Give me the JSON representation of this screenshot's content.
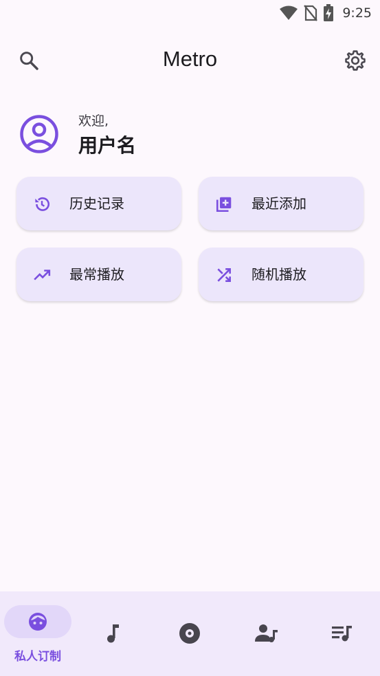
{
  "status_bar": {
    "time": "9:25",
    "icons": [
      "wifi-icon",
      "no-sim-icon",
      "battery-charging-icon"
    ]
  },
  "app_bar": {
    "title": "Metro",
    "left_icon": "search-icon",
    "right_icon": "settings-gear-icon"
  },
  "welcome": {
    "greeting": "欢迎,",
    "username": "用户名",
    "avatar_icon": "account-circle-icon"
  },
  "cards": [
    {
      "label": "历史记录",
      "icon": "history-icon"
    },
    {
      "label": "最近添加",
      "icon": "library-add-icon"
    },
    {
      "label": "最常播放",
      "icon": "trending-up-icon"
    },
    {
      "label": "随机播放",
      "icon": "shuffle-icon"
    }
  ],
  "bottom_nav": {
    "active_label": "私人订制",
    "items": [
      {
        "icon": "face-icon",
        "label": "私人订制",
        "active": true
      },
      {
        "icon": "music-note-icon"
      },
      {
        "icon": "album-icon"
      },
      {
        "icon": "artist-icon"
      },
      {
        "icon": "playlist-icon"
      }
    ]
  },
  "colors": {
    "accent": "#7a4fdf",
    "card_bg": "#ece6fb",
    "background": "#fdf8fd",
    "nav_bg": "#f1e9fb"
  }
}
